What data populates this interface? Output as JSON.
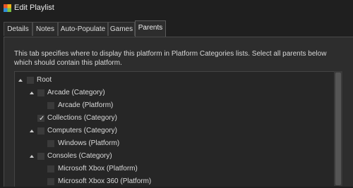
{
  "window": {
    "title": "Edit Playlist",
    "icon": "launchbox-logo-icon"
  },
  "tabs": [
    {
      "label": "Details"
    },
    {
      "label": "Notes"
    },
    {
      "label": "Auto-Populate"
    },
    {
      "label": "Games"
    },
    {
      "label": "Parents",
      "active": true
    }
  ],
  "description": "This tab specifies where to display this platform in Platform Categories lists. Select all parents below which should contain this platform.",
  "tree": [
    {
      "label": "Root",
      "expanded": true,
      "checked": false
    },
    {
      "label": "Arcade (Category)",
      "expanded": true,
      "checked": false
    },
    {
      "label": "Arcade (Platform)",
      "checked": false
    },
    {
      "label": "Collections (Category)",
      "checked": true
    },
    {
      "label": "Computers (Category)",
      "expanded": true,
      "checked": false
    },
    {
      "label": "Windows (Platform)",
      "checked": false
    },
    {
      "label": "Consoles (Category)",
      "expanded": true,
      "checked": false
    },
    {
      "label": "Microsoft Xbox (Platform)",
      "checked": false
    },
    {
      "label": "Microsoft Xbox 360 (Platform)",
      "checked": false
    }
  ],
  "colors": {
    "background": "#1f1f1f",
    "panel": "#2d2d2d",
    "text": "#d6d6d6"
  }
}
